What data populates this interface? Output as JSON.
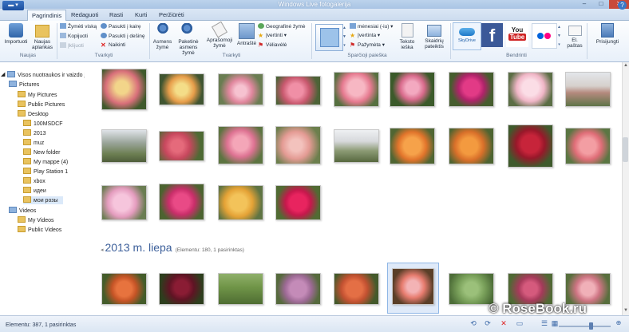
{
  "window": {
    "title": "Windows Live fotogalerija"
  },
  "tabs": [
    {
      "label": "Pagrindinis",
      "active": true
    },
    {
      "label": "Redaguoti"
    },
    {
      "label": "Rasti"
    },
    {
      "label": "Kurti"
    },
    {
      "label": "Peržiūrėti"
    }
  ],
  "ribbon": {
    "groups": {
      "naujas": "Naujas",
      "tvarkyti": "Tvarkyti",
      "tvarkyti2": "Tvarkyti",
      "sparcioji": "Sparčioji paieška",
      "bendrinti": "Bendrinti"
    },
    "importuoti": "Importuoti",
    "naujas_aplankas": "Naujas aplankas",
    "zymeti_viska": "Žymėti viską",
    "kopijuoti": "Kopijuoti",
    "iklijuoti": "Įklijuoti",
    "pasukti_kaire": "Pasukti į kairę",
    "pasukti_desine": "Pasukti į dešinę",
    "naikinti": "Naikinti",
    "asmens_zyme": "Asmens žymė",
    "paketine_zyme": "Paketinė asmens žymė",
    "aprasomoji_zyme": "Aprašomoji žymė",
    "antraste": "Antraštė",
    "geografine_zyme": "Geografinė žymė",
    "ivertinti": "Įvertinti",
    "veliaveles": "Vėliavėlė",
    "menesiai": "mėnesiai (-iu)",
    "ivertinta": "Įvertinta",
    "pazymeta": "Pažymėta",
    "teksto_ieska": "Teksto ieška",
    "skaidriu_pateiktis": "Skaidrių pateiktis",
    "skydrive": "SkyDrive",
    "el_pastas": "El. paštas",
    "prisijungti": "Prisijungti"
  },
  "nav": {
    "root": "Visos nuotraukos ir vaizdo į",
    "pictures": "Pictures",
    "my_pictures": "My Pictures",
    "public_pictures": "Public Pictures",
    "desktop": "Desktop",
    "f_100msdcf": "100MSDCF",
    "f_2013": "2013",
    "f_muz": "muz",
    "f_new_folder": "New folder",
    "f_my_mappe": "My mappe (4)",
    "f_play_station": "Play Station 1",
    "f_xbox": "xbox",
    "f_idei": "идеи",
    "f_moi_rozy": "мои розы",
    "videos": "Videos",
    "my_videos": "My Videos",
    "public_videos": "Public Videos"
  },
  "content": {
    "month_header": "2013 m. liepa",
    "month_sub": "(Elementu: 180, 1 pasirinktas)"
  },
  "status": {
    "text": "Elementu: 387, 1 pasirinktas"
  },
  "watermark": "© RoseBook.ru",
  "colors": {
    "accent": "#1b4f9e",
    "selection": "#dfeaf9",
    "header": "#3c5f9a"
  }
}
